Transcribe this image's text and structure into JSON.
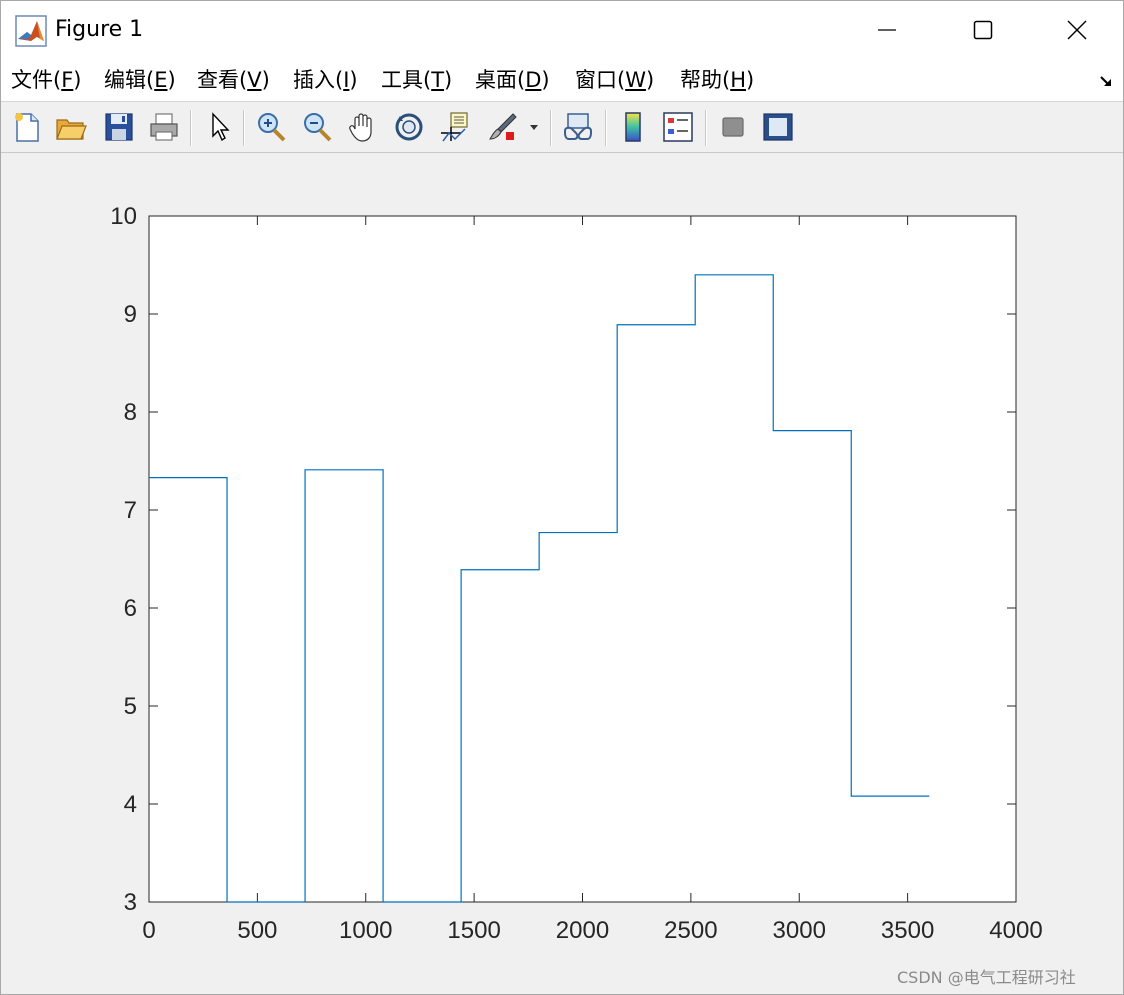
{
  "window": {
    "title": "Figure 1",
    "controls": {
      "minimize_icon": "minimize-icon",
      "maximize_icon": "maximize-icon",
      "close_icon": "close-icon"
    }
  },
  "menu": {
    "items": [
      {
        "label": "文件(",
        "key": "F",
        "suffix": ")"
      },
      {
        "label": "编辑(",
        "key": "E",
        "suffix": ")"
      },
      {
        "label": "查看(",
        "key": "V",
        "suffix": ")"
      },
      {
        "label": "插入(",
        "key": "I",
        "suffix": ")"
      },
      {
        "label": "工具(",
        "key": "T",
        "suffix": ")"
      },
      {
        "label": "桌面(",
        "key": "D",
        "suffix": ")"
      },
      {
        "label": "窗口(",
        "key": "W",
        "suffix": ")"
      },
      {
        "label": "帮助(",
        "key": "H",
        "suffix": ")"
      }
    ]
  },
  "toolbar": {
    "buttons": [
      "new-figure-icon",
      "open-file-icon",
      "save-icon",
      "print-icon",
      "edit-plot-arrow-icon",
      "zoom-in-icon",
      "zoom-out-icon",
      "pan-hand-icon",
      "rotate-3d-icon",
      "data-cursor-icon",
      "brush-icon",
      "link-plot-icon",
      "colorbar-icon",
      "legend-icon",
      "hide-plot-tools-icon",
      "show-plot-tools-icon"
    ]
  },
  "colors": {
    "line": "#0072bd",
    "axes_background": "#ffffff",
    "figure_background": "#f0f0f0",
    "axes_edge": "#262626"
  },
  "chart_data": {
    "type": "line",
    "style": "stairs",
    "x": [
      0,
      360,
      360,
      720,
      720,
      1080,
      1080,
      1440,
      1440,
      1800,
      1800,
      2160,
      2160,
      2520,
      2520,
      2880,
      2880,
      3240,
      3240,
      3600
    ],
    "y": [
      7.33,
      7.33,
      3.0,
      3.0,
      7.41,
      7.41,
      3.0,
      3.0,
      6.39,
      6.39,
      6.77,
      6.77,
      8.89,
      8.89,
      9.4,
      9.4,
      7.81,
      7.81,
      4.08,
      4.08
    ],
    "xlim": [
      0,
      4000
    ],
    "ylim": [
      3,
      10
    ],
    "xticks": [
      "0",
      "500",
      "1000",
      "1500",
      "2000",
      "2500",
      "3000",
      "3500",
      "4000"
    ],
    "xtick_values": [
      0,
      500,
      1000,
      1500,
      2000,
      2500,
      3000,
      3500,
      4000
    ],
    "yticks": [
      "3",
      "4",
      "5",
      "6",
      "7",
      "8",
      "9",
      "10"
    ],
    "ytick_values": [
      3,
      4,
      5,
      6,
      7,
      8,
      9,
      10
    ],
    "title": "",
    "xlabel": "",
    "ylabel": "",
    "grid": false
  },
  "watermark": "CSDN @电气工程研习社"
}
